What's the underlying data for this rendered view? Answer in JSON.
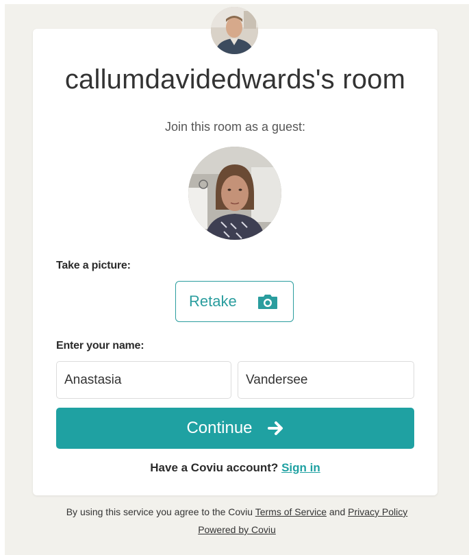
{
  "room": {
    "title": "callumdavidedwards's room"
  },
  "guest": {
    "prompt": "Join this room as a guest:"
  },
  "picture": {
    "label": "Take a picture:",
    "retake_label": "Retake",
    "camera_icon": "camera-icon"
  },
  "name": {
    "label": "Enter your name:",
    "first_value": "Anastasia",
    "last_value": "Vandersee"
  },
  "continue": {
    "label": "Continue",
    "icon": "arrow-right-icon"
  },
  "account": {
    "prompt": "Have a Coviu account?",
    "signin_label": "Sign in"
  },
  "footer": {
    "agree_prefix": "By using this service you agree to the Coviu",
    "terms_label": "Terms of Service",
    "and_text": "and",
    "privacy_label": "Privacy Policy",
    "powered_label": "Powered by Coviu"
  },
  "colors": {
    "accent": "#1fa1a2",
    "page_background": "#f2f1ec",
    "card_background": "#ffffff"
  }
}
